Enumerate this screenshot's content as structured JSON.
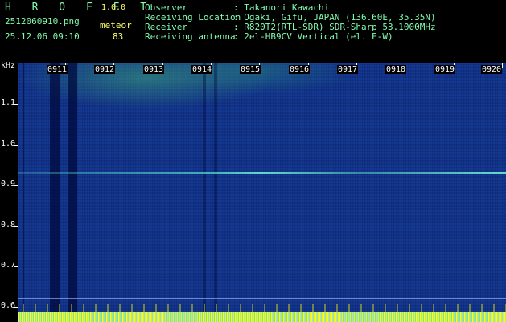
{
  "header": {
    "logo": "H R O F F T",
    "version": "1.0.0",
    "filename": "2512060910.png",
    "category": "meteor",
    "datetime": "25.12.06 09:10",
    "count": "83",
    "info": [
      {
        "label": "Observer",
        "value": ": Takanori Kawachi"
      },
      {
        "label": "Receiving Location",
        "value": ": Ogaki, Gifu, JAPAN (136.60E, 35.35N)"
      },
      {
        "label": "Receiver",
        "value": ": R820T2(RTL-SDR) SDR-Sharp 53.1000MHz"
      },
      {
        "label": "Receiving antenna",
        "value": ": 2el-HB9CV Vertical (el. E-W)"
      }
    ]
  },
  "axis": {
    "unit": "kHz",
    "y_labels": [
      "1.1",
      "1.0",
      "0.9",
      "0.8",
      "0.7",
      "0.6"
    ],
    "time_labels": [
      "0911",
      "0912",
      "0913",
      "0914",
      "0915",
      "0916",
      "0917",
      "0918",
      "0919",
      "0920"
    ]
  },
  "colors": {
    "spectrum_bg": "#0c2f8c",
    "header_text": "#7fffb0",
    "accent_yellow": "#ffff66"
  }
}
